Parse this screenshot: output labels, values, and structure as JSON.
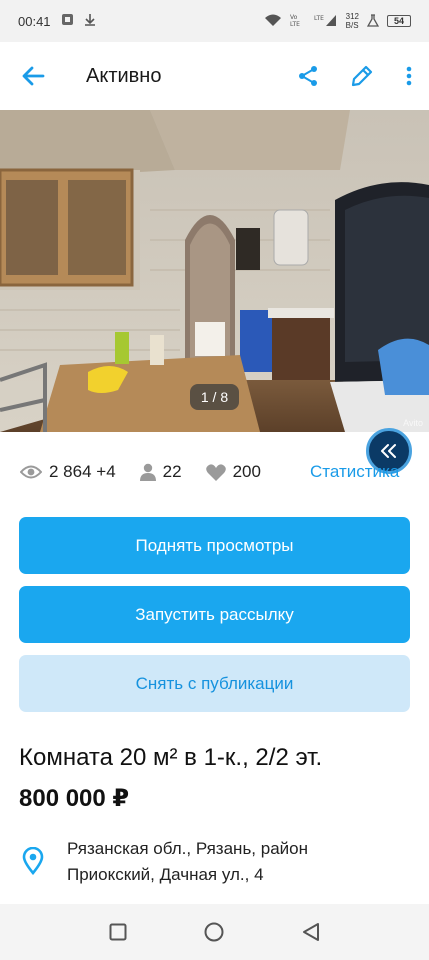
{
  "status_bar": {
    "time": "00:41",
    "net_label": "312\nB/S",
    "battery": "54"
  },
  "app_bar": {
    "title": "Активно",
    "back_icon": "arrow-left-icon",
    "share_icon": "share-icon",
    "edit_icon": "pencil-icon",
    "more_icon": "more-vertical-icon"
  },
  "photo": {
    "counter": "1 / 8",
    "watermark": "Avito"
  },
  "stats": {
    "views": "2 864 +4",
    "contacts": "22",
    "favorites": "200",
    "link_label": "Статистика"
  },
  "actions": {
    "raise_views": "Поднять просмотры",
    "start_mailing": "Запустить рассылку",
    "unpublish": "Снять с публикации"
  },
  "listing": {
    "title": "Комната 20 м² в 1-к., 2/2 эт.",
    "price": "800 000 ₽",
    "address": "Рязанская обл., Рязань, район Приокский, Дачная ул., 4"
  },
  "colors": {
    "accent": "#1aa7ef",
    "accent_light": "#cfe8f9",
    "link": "#1a9be8"
  }
}
